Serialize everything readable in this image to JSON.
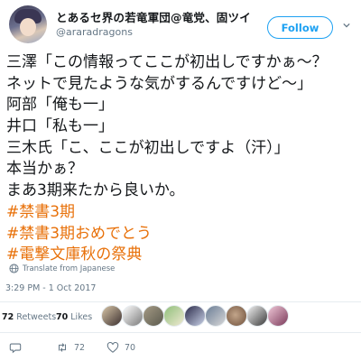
{
  "user": {
    "display_name": "とあるセ界の若竜軍団@竜党、固ツイ",
    "handle": "@araradragons",
    "follow_label": "Follow"
  },
  "tweet": {
    "lines": [
      "三澤「この情報ってここが初出しですかぁ～？",
      "ネットで見たような気がするんですけど～」",
      "阿部「俺も一」",
      "井口「私も一」",
      "三木氏「こ、ここが初出しですよ（汗）」",
      "本当かぁ？",
      "まあ3期来たから良いか。",
      "#禁書3期",
      "#禁書3期おめでとう",
      "#電撃文庫秋の祭典"
    ],
    "hashtag_color": "#e8710a"
  },
  "translate_label": "Translate from Japanese",
  "timestamp": "3:29 PM - 1 Oct 2017",
  "stats": {
    "retweets_count": "72",
    "retweets_label": "Retweets",
    "likes_count": "70",
    "likes_label": "Likes"
  },
  "actions": {
    "reply_count": "",
    "retweet_count": "72",
    "like_count": "70"
  },
  "accent_color": "#1da1f2"
}
